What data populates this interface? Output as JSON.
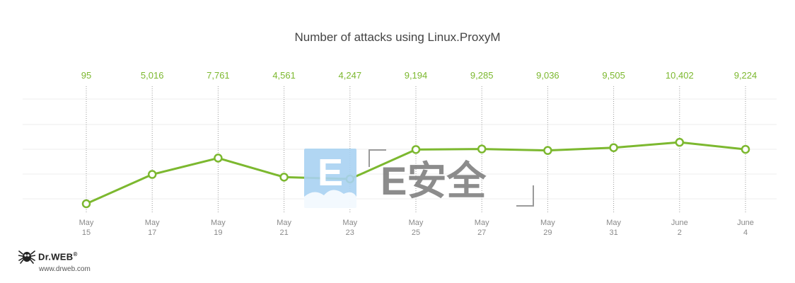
{
  "chart_data": {
    "type": "line",
    "title": "Number of attacks using Linux.ProxyM",
    "categories": [
      [
        "May",
        "15"
      ],
      [
        "May",
        "17"
      ],
      [
        "May",
        "19"
      ],
      [
        "May",
        "21"
      ],
      [
        "May",
        "23"
      ],
      [
        "May",
        "25"
      ],
      [
        "May",
        "27"
      ],
      [
        "May",
        "29"
      ],
      [
        "May",
        "31"
      ],
      [
        "June",
        "2"
      ],
      [
        "June",
        "4"
      ]
    ],
    "series": [
      {
        "values": [
          95,
          5016,
          7761,
          4561,
          4247,
          9194,
          9285,
          9036,
          9505,
          10402,
          9224
        ]
      }
    ],
    "value_labels": [
      "95",
      "5,016",
      "7,761",
      "4,561",
      "4,247",
      "9,194",
      "9,285",
      "9,036",
      "9,505",
      "10,402",
      "9,224"
    ],
    "ylim": [
      -7500,
      23000
    ],
    "grid": true,
    "legend": "none",
    "colors": {
      "line": "#7cb82f",
      "value_label": "#7cb82f",
      "grid": "#eeeeee",
      "guide": "#999999",
      "tick_text": "#8a8a8a",
      "title_text": "#444444"
    }
  },
  "brand": {
    "name": "Dr.WEB",
    "mark": "®",
    "url": "www.drweb.com",
    "icon": "spider-icon"
  },
  "watermark": {
    "text": "E安全",
    "icon_letter": "E",
    "colors": {
      "icon": "#a9d2f2",
      "text": "#808080",
      "frame": "#9a9a9a"
    }
  }
}
